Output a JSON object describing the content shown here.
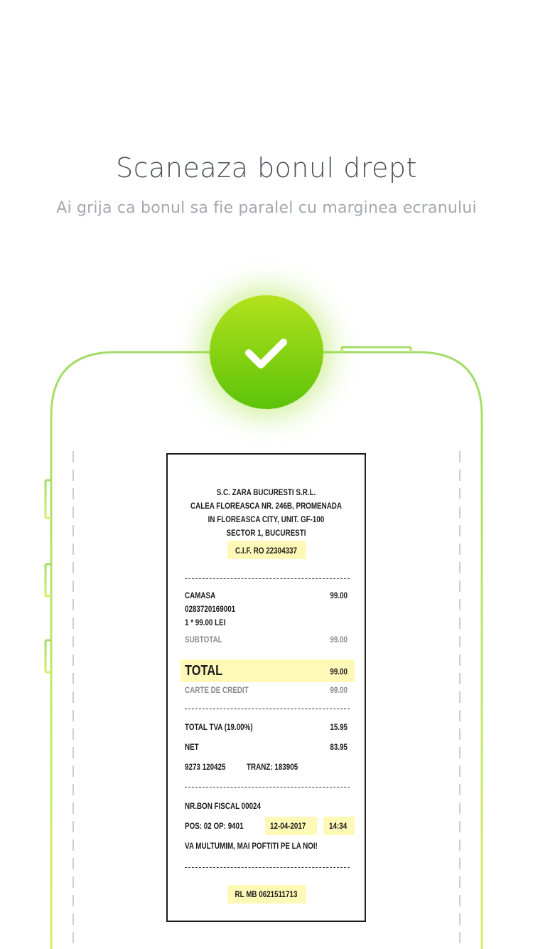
{
  "header": {
    "title": "Scaneaza bonul drept",
    "subtitle": "Ai grija ca bonul sa fie paralel cu marginea ecranului"
  },
  "colors": {
    "accent_green_top": "#b3e21c",
    "accent_green_bottom": "#5cc30a",
    "highlight_yellow": "#fff9b8",
    "phone_outline": "#a8e06a"
  },
  "status_icon": "checkmark-icon",
  "receipt": {
    "company": [
      "S.C. ZARA BUCURESTI S.R.L.",
      "CALEA FLOREASCA NR. 246B, PROMENADA",
      "IN FLOREASCA CITY, UNIT. GF-100",
      "SECTOR 1, BUCURESTI"
    ],
    "cif": "C.I.F. RO 22304337",
    "item_name": "CAMASA",
    "item_price": "99.00",
    "item_code": "0283720169001",
    "item_qty": "1 * 99.00 LEI",
    "subtotal_label": "SUBTOTAL",
    "subtotal_value": "99.00",
    "total_label": "TOTAL",
    "total_value": "99.00",
    "card_label": "CARTE DE CREDIT",
    "card_value": "99.00",
    "tva_label": "TOTAL TVA (19.00%)",
    "tva_value": "15.95",
    "net_label": "NET",
    "net_value": "83.95",
    "terminal": "9273 120425",
    "tranz": "TRANZ: 183905",
    "bon_fiscal": "NR.BON FISCAL 00024",
    "pos": "POS: 02 OP: 9401",
    "date": "12-04-2017",
    "time": "14:34",
    "thanks": "VA MULTUMIM, MAI POFTITI PE LA NOI!",
    "rl": "RL MB 0621511713"
  }
}
